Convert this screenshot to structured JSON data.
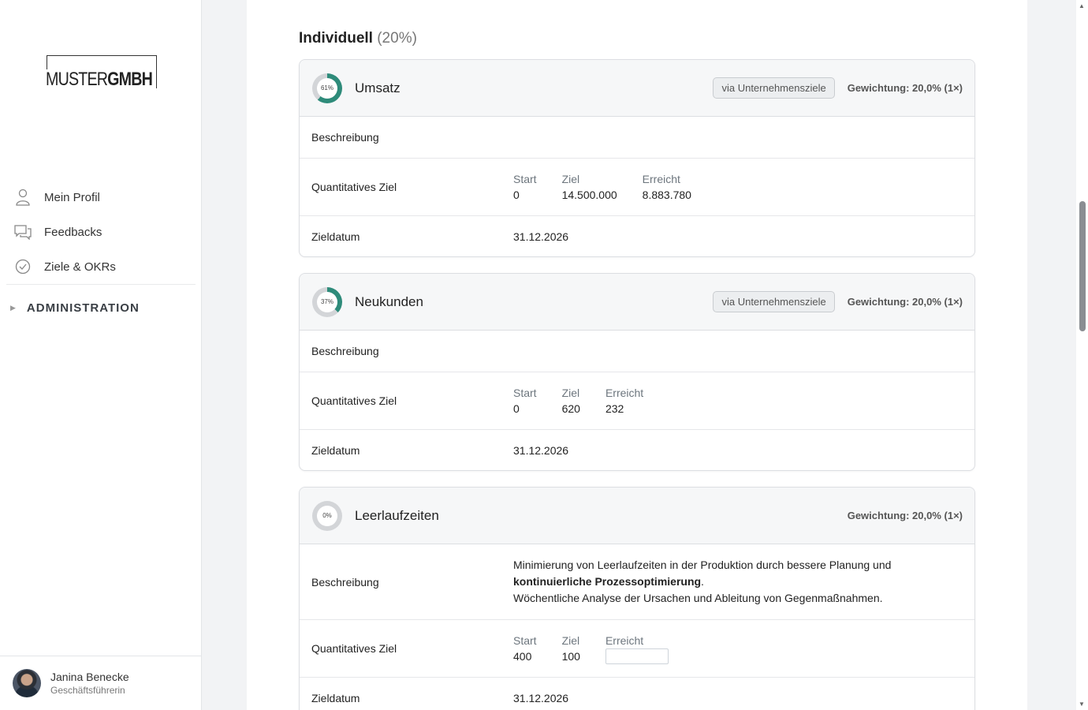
{
  "brand": {
    "name_thin": "MUSTER",
    "name_bold": "GMBH"
  },
  "sidebar": {
    "items": [
      {
        "label": "Mein Profil",
        "icon": "user-icon"
      },
      {
        "label": "Feedbacks",
        "icon": "chat-icon"
      },
      {
        "label": "Ziele & OKRs",
        "icon": "check-circle-icon"
      }
    ],
    "admin_label": "ADMINISTRATION"
  },
  "user": {
    "name": "Janina Benecke",
    "role": "Geschäftsführerin"
  },
  "section": {
    "title": "Individuell",
    "percent": "(20%)"
  },
  "labels": {
    "description": "Beschreibung",
    "quant_goal": "Quantitatives Ziel",
    "target_date": "Zieldatum",
    "start": "Start",
    "goal": "Ziel",
    "achieved": "Erreicht",
    "via": "via Unternehmensziele"
  },
  "goals": [
    {
      "title": "Umsatz",
      "progress": 61,
      "progress_label": "61%",
      "via": "via Unternehmensziele",
      "weight": "Gewichtung: 20,0% (1×)",
      "start": "0",
      "target": "14.500.000",
      "achieved": "8.883.780",
      "date": "31.12.2026"
    },
    {
      "title": "Neukunden",
      "progress": 37,
      "progress_label": "37%",
      "via": "via Unternehmensziele",
      "weight": "Gewichtung: 20,0% (1×)",
      "start": "0",
      "target": "620",
      "achieved": "232",
      "date": "31.12.2026"
    },
    {
      "title": "Leerlaufzeiten",
      "progress": 0,
      "progress_label": "0%",
      "weight": "Gewichtung: 20,0% (1×)",
      "description_line1": "Minimierung von Leerlaufzeiten in der Produktion durch bessere Planung und",
      "description_bold": "kontinuierliche Prozessoptimierung",
      "description_after": ".",
      "description_line3": "Wöchentliche Analyse der Ursachen und Ableitung von Gegenmaßnahmen.",
      "start": "400",
      "target": "100",
      "achieved": "",
      "date": "31.12.2026"
    }
  ],
  "colors": {
    "progress": "#2e8b7a",
    "track": "#d3d5d8"
  }
}
